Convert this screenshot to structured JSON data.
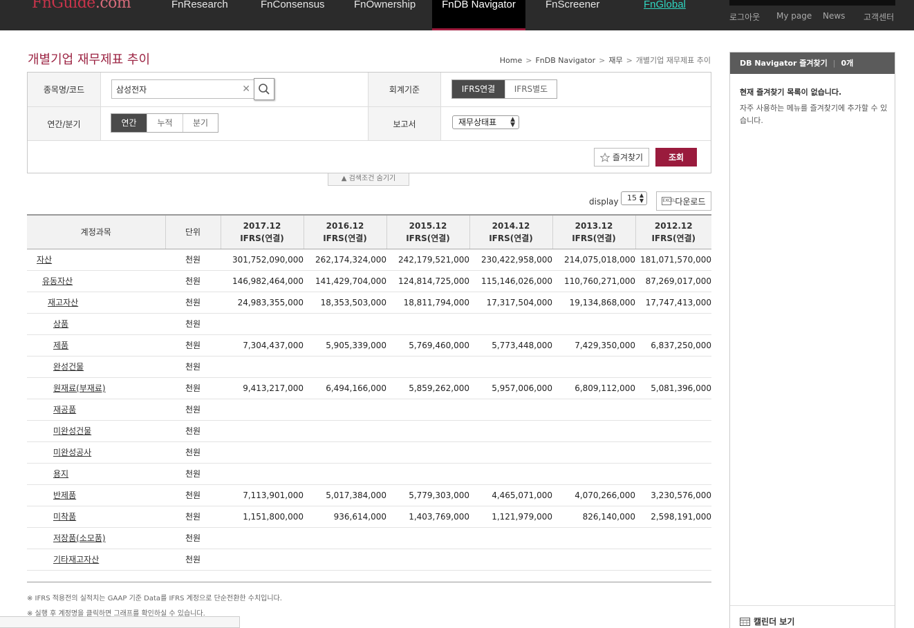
{
  "header": {
    "logo": "FnGuide",
    "logo_suffix": ".com",
    "nav": [
      {
        "label": "FnResearch"
      },
      {
        "label": "FnConsensus"
      },
      {
        "label": "FnOwnership"
      },
      {
        "label": "FnDB Navigator"
      },
      {
        "label": "FnScreener"
      },
      {
        "label": "FnGlobal"
      }
    ],
    "util": [
      "로그아웃",
      "My page",
      "News",
      "고객센터"
    ]
  },
  "page_title": "개별기업 재무제표 추이",
  "breadcrumb": [
    "Home",
    "FnDB Navigator",
    "재무",
    "개별기업 재무제표 추이"
  ],
  "form": {
    "company_label": "종목명/코드",
    "company_value": "삼성전자",
    "standard_label": "회계기준",
    "standard_options": [
      "IFRS연결",
      "IFRS별도"
    ],
    "standard_selected": "IFRS연결",
    "period_label": "연간/분기",
    "period_options": [
      "연간",
      "누적",
      "분기"
    ],
    "period_selected": "연간",
    "report_label": "보고서",
    "report_value": "재무상태표",
    "favorite_label": "즐겨찾기",
    "submit_label": "조회",
    "toggle_label": "검색조건 숨기기"
  },
  "display": {
    "label": "display",
    "value": "15"
  },
  "download_label": "다운로드",
  "download_icon": "EXCEL",
  "table": {
    "headers": {
      "account": "계정과목",
      "unit": "단위"
    },
    "periods": [
      {
        "date": "2017.12",
        "basis": "IFRS(연결)"
      },
      {
        "date": "2016.12",
        "basis": "IFRS(연결)"
      },
      {
        "date": "2015.12",
        "basis": "IFRS(연결)"
      },
      {
        "date": "2014.12",
        "basis": "IFRS(연결)"
      },
      {
        "date": "2013.12",
        "basis": "IFRS(연결)"
      },
      {
        "date": "2012.12",
        "basis": "IFRS(연결)"
      }
    ],
    "rows": [
      {
        "name": "자산",
        "level": 0,
        "unit": "천원",
        "values": [
          "301,752,090,000",
          "262,174,324,000",
          "242,179,521,000",
          "230,422,958,000",
          "214,075,018,000",
          "181,071,570,000"
        ]
      },
      {
        "name": "유동자산",
        "level": 1,
        "unit": "천원",
        "values": [
          "146,982,464,000",
          "141,429,704,000",
          "124,814,725,000",
          "115,146,026,000",
          "110,760,271,000",
          "87,269,017,000"
        ]
      },
      {
        "name": "재고자산",
        "level": 2,
        "unit": "천원",
        "values": [
          "24,983,355,000",
          "18,353,503,000",
          "18,811,794,000",
          "17,317,504,000",
          "19,134,868,000",
          "17,747,413,000"
        ]
      },
      {
        "name": "상품",
        "level": 3,
        "unit": "천원",
        "values": [
          "",
          "",
          "",
          "",
          "",
          ""
        ]
      },
      {
        "name": "제품",
        "level": 3,
        "unit": "천원",
        "values": [
          "7,304,437,000",
          "5,905,339,000",
          "5,769,460,000",
          "5,773,448,000",
          "7,429,350,000",
          "6,837,250,000"
        ]
      },
      {
        "name": "완성건물",
        "level": 3,
        "unit": "천원",
        "values": [
          "",
          "",
          "",
          "",
          "",
          ""
        ]
      },
      {
        "name": "원재료(부재료)",
        "level": 3,
        "unit": "천원",
        "values": [
          "9,413,217,000",
          "6,494,166,000",
          "5,859,262,000",
          "5,957,006,000",
          "6,809,112,000",
          "5,081,396,000"
        ]
      },
      {
        "name": "재공품",
        "level": 3,
        "unit": "천원",
        "values": [
          "",
          "",
          "",
          "",
          "",
          ""
        ]
      },
      {
        "name": "미완성건물",
        "level": 3,
        "unit": "천원",
        "values": [
          "",
          "",
          "",
          "",
          "",
          ""
        ]
      },
      {
        "name": "미완성공사",
        "level": 3,
        "unit": "천원",
        "values": [
          "",
          "",
          "",
          "",
          "",
          ""
        ]
      },
      {
        "name": "용지",
        "level": 3,
        "unit": "천원",
        "values": [
          "",
          "",
          "",
          "",
          "",
          ""
        ]
      },
      {
        "name": "반제품",
        "level": 3,
        "unit": "천원",
        "values": [
          "7,113,901,000",
          "5,017,384,000",
          "5,779,303,000",
          "4,465,071,000",
          "4,070,266,000",
          "3,230,576,000"
        ]
      },
      {
        "name": "미착품",
        "level": 3,
        "unit": "천원",
        "values": [
          "1,151,800,000",
          "936,614,000",
          "1,403,769,000",
          "1,121,979,000",
          "826,140,000",
          "2,598,191,000"
        ]
      },
      {
        "name": "저장품(소모품)",
        "level": 3,
        "unit": "천원",
        "values": [
          "",
          "",
          "",
          "",
          "",
          ""
        ]
      },
      {
        "name": "기타재고자산",
        "level": 3,
        "unit": "천원",
        "values": [
          "",
          "",
          "",
          "",
          "",
          ""
        ]
      }
    ]
  },
  "notes": [
    "※ IFRS 적용전의 실적치는 GAAP 기준 Data를 IFRS 계정으로 단순전환한 수치입니다.",
    "※ 실행 후 계정명을 클릭하면 그래프를 확인하실 수 있습니다."
  ],
  "side": {
    "title": "DB Navigator 즐겨찾기",
    "count": "0개",
    "empty": "현재 즐겨찾기 목록이 없습니다.",
    "desc": "자주 사용하는 메뉴를 즐겨찾기에 추가할 수 있습니다.",
    "calendar": "캘린더 보기"
  },
  "colors": {
    "accent": "#9a1b3d",
    "nav_bg": "#2b2b2b",
    "global_link": "#2fd6c1"
  }
}
